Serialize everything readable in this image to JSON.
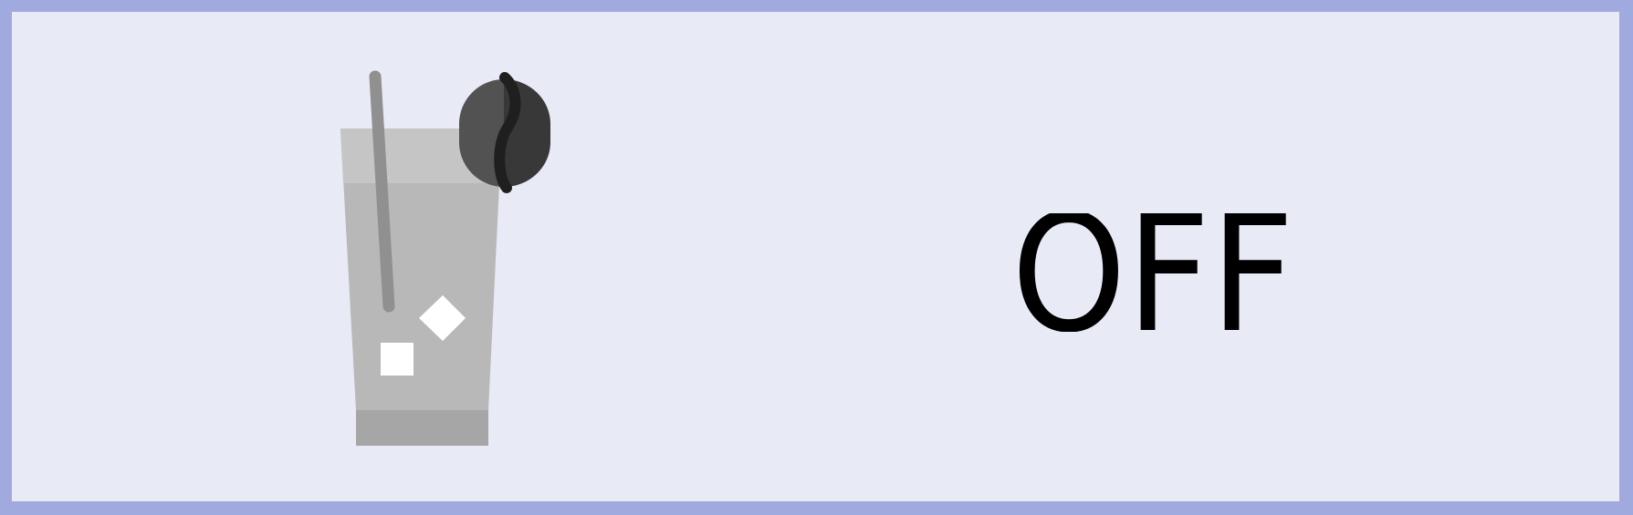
{
  "toggle": {
    "state_label": "OFF",
    "state": "off"
  },
  "icon": {
    "name": "iced-coffee-icon"
  },
  "colors": {
    "outer_border": "#a0aade",
    "background": "#e8eaf6",
    "text": "#000000",
    "glass": "#b8b8b8",
    "glass_top": "#c5c5c5",
    "glass_base": "#a6a6a6",
    "straw": "#909090",
    "ice": "#ffffff",
    "bean_left": "#525252",
    "bean_right": "#383838",
    "bean_crease": "#1f1f1f"
  }
}
